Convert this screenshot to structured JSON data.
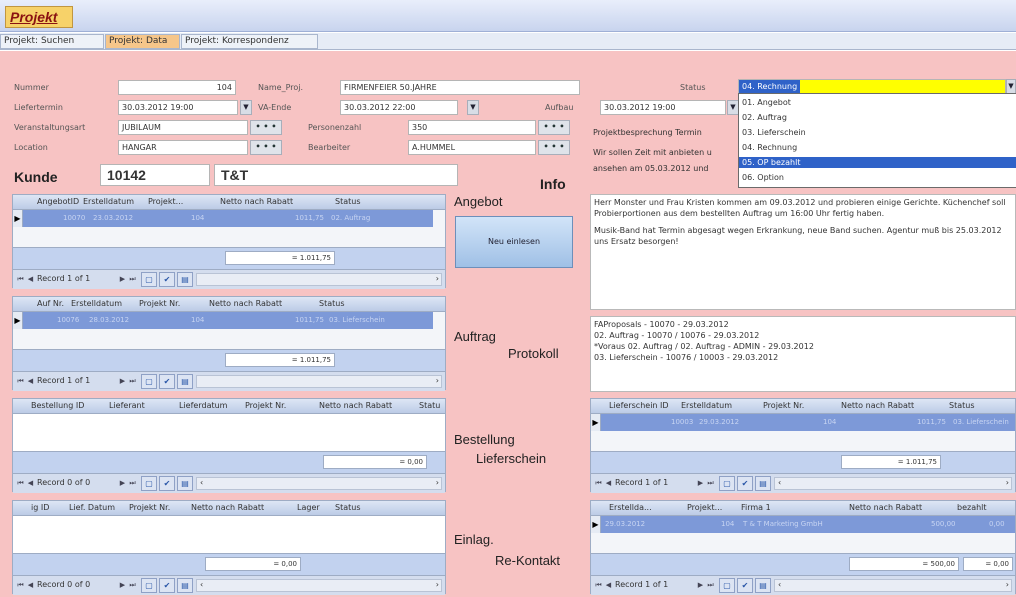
{
  "app": {
    "title": "Projekt"
  },
  "tabs": [
    {
      "label": "Projekt: Suchen"
    },
    {
      "label": "Projekt: Data"
    },
    {
      "label": "Projekt: Korrespondenz"
    }
  ],
  "form": {
    "nummer_label": "Nummer",
    "nummer": "104",
    "name_label": "Name_Proj.",
    "name": "FIRMENFEIER 50.JAHRE",
    "status_label": "Status",
    "status": "04. Rechnung",
    "liefertermin_label": "Liefertermin",
    "liefertermin": "30.03.2012 19:00",
    "vaende_label": "VA-Ende",
    "vaende": "30.03.2012 22:00",
    "aufbau_label": "Aufbau",
    "aufbau": "30.03.2012 19:00",
    "veranstaltungsart_label": "Veranstaltungsart",
    "veranstaltungsart": "JUBILAUM",
    "personenzahl_label": "Personenzahl",
    "personenzahl": "350",
    "location_label": "Location",
    "location": "HANGAR",
    "bearbeiter_label": "Bearbeiter",
    "bearbeiter": "A.HUMMEL",
    "kunde_label": "Kunde",
    "kunde_nr": "10142",
    "kunde_name": "T&T",
    "info_label": "Info",
    "three_dots": "• • •"
  },
  "status_options": [
    "01. Angebot",
    "02. Auftrag",
    "03. Lieferschein",
    "04. Rechnung",
    "05. OP bezahlt",
    "06. Option"
  ],
  "sections": {
    "angebot": "Angebot",
    "auftrag": "Auftrag",
    "protokoll": "Protokoll",
    "bestellung": "Bestellung",
    "lieferschein": "Lieferschein",
    "einlag": "Einlag.",
    "rekontakt": "Re-Kontakt"
  },
  "new_button": "Neu einlesen",
  "info_preview": {
    "line1": "Projektbesprechung Termin",
    "line2": "Wir sollen Zeit mit anbieten u",
    "line3": "ansehen am 05.03.2012 und"
  },
  "info_text": {
    "p1": "Herr Monster und Frau Kristen kommen am 09.03.2012 und probieren einige Gerichte. Küchenchef soll Probierportionen aus dem bestellten Auftrag um 16:00 Uhr fertig haben.",
    "p2": "Musik-Band hat Termin abgesagt wegen Erkrankung, neue Band suchen. Agentur muß bis 25.03.2012 uns Ersatz besorgen!"
  },
  "protokoll": [
    "FAProposals - 10070 - 29.03.2012",
    "02. Auftrag - 10070 / 10076 - 29.03.2012",
    "*Voraus 02. Auftrag / 02. Auftrag - ADMIN - 29.03.2012",
    "03. Lieferschein - 10076 / 10003 - 29.03.2012"
  ],
  "grids": {
    "angebot": {
      "headers": [
        "AngebotID",
        "Erstelldatum",
        "Projekt...",
        "Netto nach Rabatt",
        "Status"
      ],
      "row": [
        "10070",
        "23.03.2012",
        "104",
        "1011,75",
        "02. Auftrag"
      ],
      "sum": "= 1.011,75",
      "record": "Record 1 of 1"
    },
    "auftrag": {
      "headers": [
        "Auf Nr.",
        "Erstelldatum",
        "Projekt Nr.",
        "Netto nach Rabatt",
        "Status"
      ],
      "row": [
        "10076",
        "28.03.2012",
        "104",
        "1011,75",
        "03. Lieferschein"
      ],
      "sum": "= 1.011,75",
      "record": "Record 1 of 1"
    },
    "bestellung": {
      "headers": [
        "Bestellung ID",
        "Lieferant",
        "Lieferdatum",
        "Projekt Nr.",
        "Netto nach Rabatt",
        "Statu"
      ],
      "sum": "= 0,00",
      "record": "Record 0 of 0"
    },
    "einlag": {
      "headers": [
        "ig ID",
        "Lief. Datum",
        "Projekt Nr.",
        "Netto nach Rabatt",
        "Lager",
        "Status"
      ],
      "sum": "= 0,00",
      "record": "Record 0 of 0"
    },
    "lieferschein": {
      "headers": [
        "Lieferschein ID",
        "Erstelldatum",
        "Projekt Nr.",
        "Netto nach Rabatt",
        "Status"
      ],
      "row": [
        "10003",
        "29.03.2012",
        "104",
        "1011,75",
        "03. Lieferschein"
      ],
      "sum": "= 1.011,75",
      "record": "Record 1 of 1"
    },
    "rekontakt": {
      "headers": [
        "Erstellda...",
        "Projekt...",
        "Firma 1",
        "Netto nach Rabatt",
        "bezahlt"
      ],
      "row": [
        "29.03.2012",
        "104",
        "T & T Marketing GmbH",
        "500,00",
        "0,00"
      ],
      "sum": "= 500,00",
      "sum2": "= 0,00",
      "record": "Record 1 of 1"
    }
  },
  "colors": {
    "pink": "#f7c3c3",
    "highlight": "#2f62c8",
    "status_yellow": "#ffff00"
  }
}
